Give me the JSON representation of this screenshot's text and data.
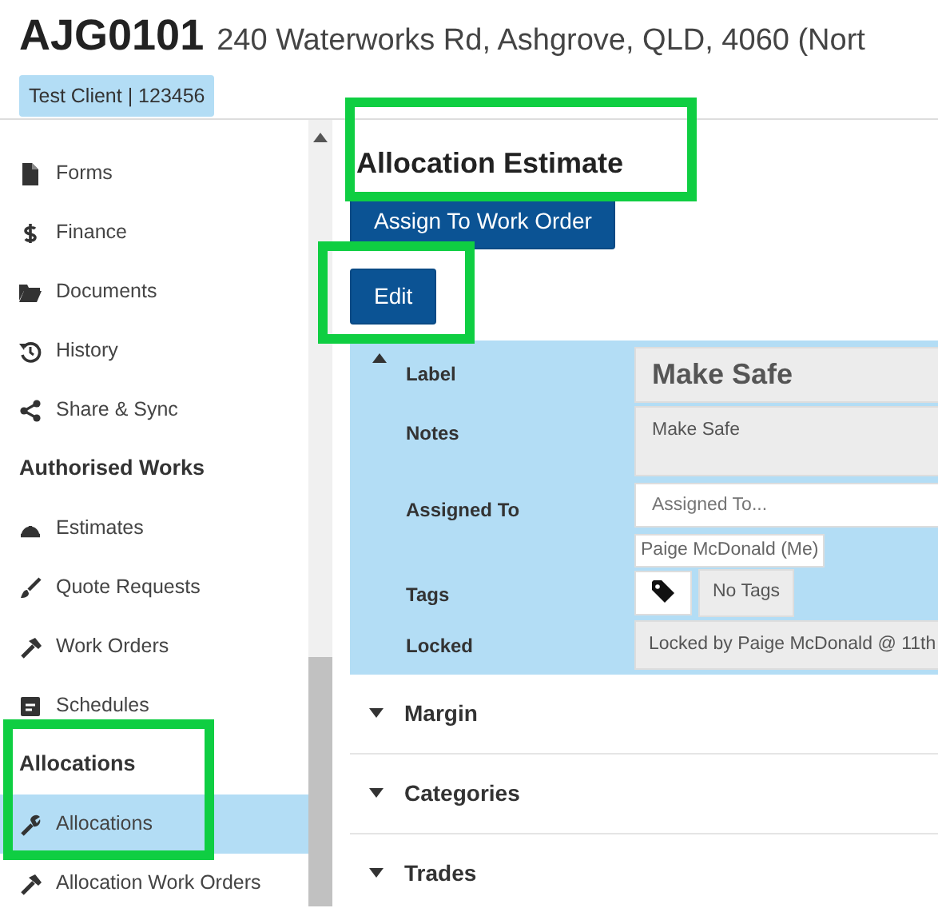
{
  "header": {
    "job_number": "AJG0101",
    "address": "240 Waterworks Rd, Ashgrove, QLD, 4060 (Nort",
    "client_badge": "Test Client | 123456"
  },
  "sidebar": {
    "items": [
      {
        "kind": "link",
        "label": "Forms",
        "selected": false,
        "highlighted": false
      },
      {
        "kind": "link",
        "label": "Finance",
        "selected": false,
        "highlighted": false
      },
      {
        "kind": "link",
        "label": "Documents",
        "selected": false,
        "highlighted": false
      },
      {
        "kind": "link",
        "label": "History",
        "selected": false,
        "highlighted": false
      },
      {
        "kind": "link",
        "label": "Share & Sync",
        "selected": false,
        "highlighted": false
      },
      {
        "kind": "heading",
        "label": "Authorised Works",
        "highlighted": false
      },
      {
        "kind": "link",
        "label": "Estimates",
        "selected": false,
        "highlighted": false
      },
      {
        "kind": "link",
        "label": "Quote Requests",
        "selected": false,
        "highlighted": false
      },
      {
        "kind": "link",
        "label": "Work Orders",
        "selected": false,
        "highlighted": false
      },
      {
        "kind": "link",
        "label": "Schedules",
        "selected": false,
        "highlighted": false
      },
      {
        "kind": "heading",
        "label": "Allocations",
        "highlighted": true
      },
      {
        "kind": "link",
        "label": "Allocations",
        "selected": true,
        "highlighted": true
      },
      {
        "kind": "link",
        "label": "Allocation Work Orders",
        "selected": false,
        "highlighted": false
      }
    ]
  },
  "main": {
    "title": "Allocation Estimate",
    "title_highlighted": true,
    "buttons": [
      {
        "label": "Assign To Work Order"
      },
      {
        "label": "Edit",
        "highlighted": true
      }
    ],
    "details": {
      "expanded": true,
      "fields": [
        {
          "kind": "title",
          "label": "Label",
          "value": "Make Safe"
        },
        {
          "kind": "textarea",
          "label": "Notes",
          "value": "Make Safe"
        },
        {
          "kind": "assign",
          "label": "Assigned To",
          "placeholder": "Assigned To...",
          "chips": [
            "Paige McDonald (Me)"
          ]
        },
        {
          "kind": "tags",
          "label": "Tags",
          "value": "No Tags"
        },
        {
          "kind": "readonly",
          "label": "Locked",
          "value": "Locked by Paige McDonald @ 11th"
        }
      ]
    },
    "sections": [
      {
        "label": "Margin",
        "expanded": false
      },
      {
        "label": "Categories",
        "expanded": false
      },
      {
        "label": "Trades",
        "expanded": false
      }
    ]
  }
}
